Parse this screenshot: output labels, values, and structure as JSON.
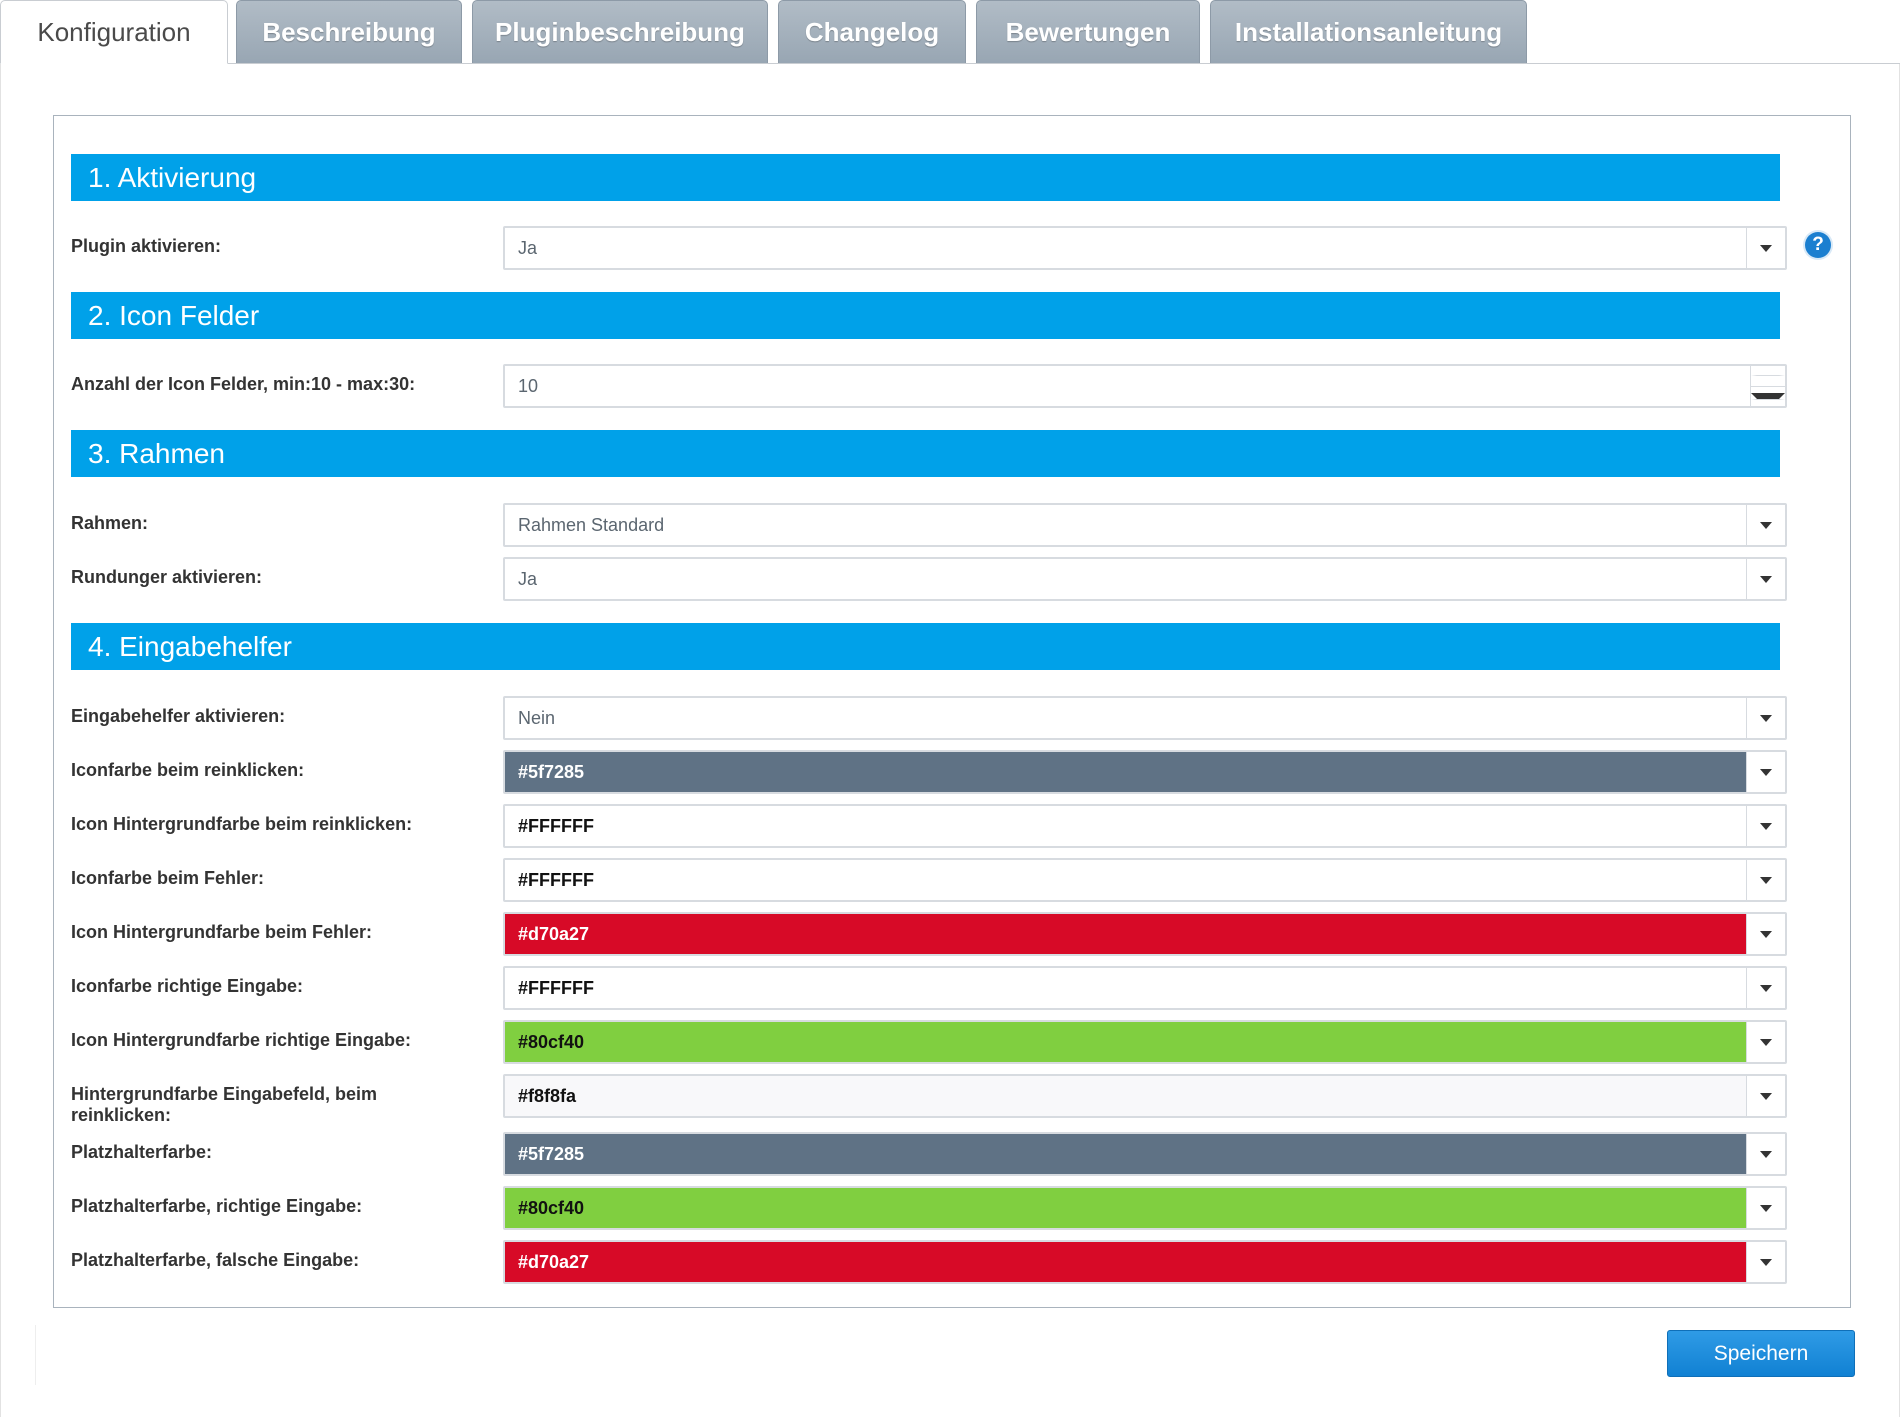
{
  "tabs": [
    {
      "label": "Konfiguration",
      "active": true
    },
    {
      "label": "Beschreibung"
    },
    {
      "label": "Pluginbeschreibung"
    },
    {
      "label": "Changelog"
    },
    {
      "label": "Bewertungen"
    },
    {
      "label": "Installationsanleitung"
    }
  ],
  "sections": {
    "aktivierung": "1. Aktivierung",
    "icon_felder": "2. Icon Felder",
    "rahmen": "3. Rahmen",
    "eingabehelfer": "4. Eingabehelfer"
  },
  "fields": {
    "plugin_aktivieren": {
      "label": "Plugin aktivieren:",
      "value": "Ja"
    },
    "anzahl_icon_felder": {
      "label": "Anzahl der Icon Felder, min:10 - max:30:",
      "value": "10"
    },
    "rahmen": {
      "label": "Rahmen:",
      "value": "Rahmen Standard"
    },
    "rundungen": {
      "label": "Rundunger aktivieren:",
      "value": "Ja"
    },
    "eingabehelfer_aktivieren": {
      "label": "Eingabehelfer aktivieren:",
      "value": "Nein"
    },
    "iconfarbe_reinklicken": {
      "label": "Iconfarbe beim reinklicken:",
      "value": "#5f7285",
      "swatch": "#5f7285"
    },
    "icon_bg_reinklicken": {
      "label": "Icon Hintergrundfarbe beim reinklicken:",
      "value": "#FFFFFF",
      "swatch": "#FFFFFF"
    },
    "iconfarbe_fehler": {
      "label": "Iconfarbe beim Fehler:",
      "value": "#FFFFFF",
      "swatch": "#FFFFFF"
    },
    "icon_bg_fehler": {
      "label": "Icon Hintergrundfarbe beim Fehler:",
      "value": "#d70a27",
      "swatch": "#d70a27"
    },
    "iconfarbe_richtig": {
      "label": "Iconfarbe richtige Eingabe:",
      "value": "#FFFFFF",
      "swatch": "#FFFFFF"
    },
    "icon_bg_richtig": {
      "label": "Icon Hintergrundfarbe richtige Eingabe:",
      "value": "#80cf40",
      "swatch": "#80cf40"
    },
    "bg_eingabefeld": {
      "label": "Hintergrundfarbe Eingabefeld, beim reinklicken:",
      "value": "#f8f8fa",
      "swatch": "#f8f8fa"
    },
    "platzhalterfarbe": {
      "label": "Platzhalterfarbe:",
      "value": "#5f7285",
      "swatch": "#5f7285"
    },
    "platzhalter_richtig": {
      "label": "Platzhalterfarbe, richtige Eingabe:",
      "value": "#80cf40",
      "swatch": "#80cf40"
    },
    "platzhalter_falsch": {
      "label": "Platzhalterfarbe, falsche Eingabe:",
      "value": "#d70a27",
      "swatch": "#d70a27"
    }
  },
  "help_icon": "question-mark-icon",
  "help_glyph": "?",
  "save_label": "Speichern",
  "colors": {
    "accent": "#00a1e9",
    "button": "#1b8ad8"
  }
}
